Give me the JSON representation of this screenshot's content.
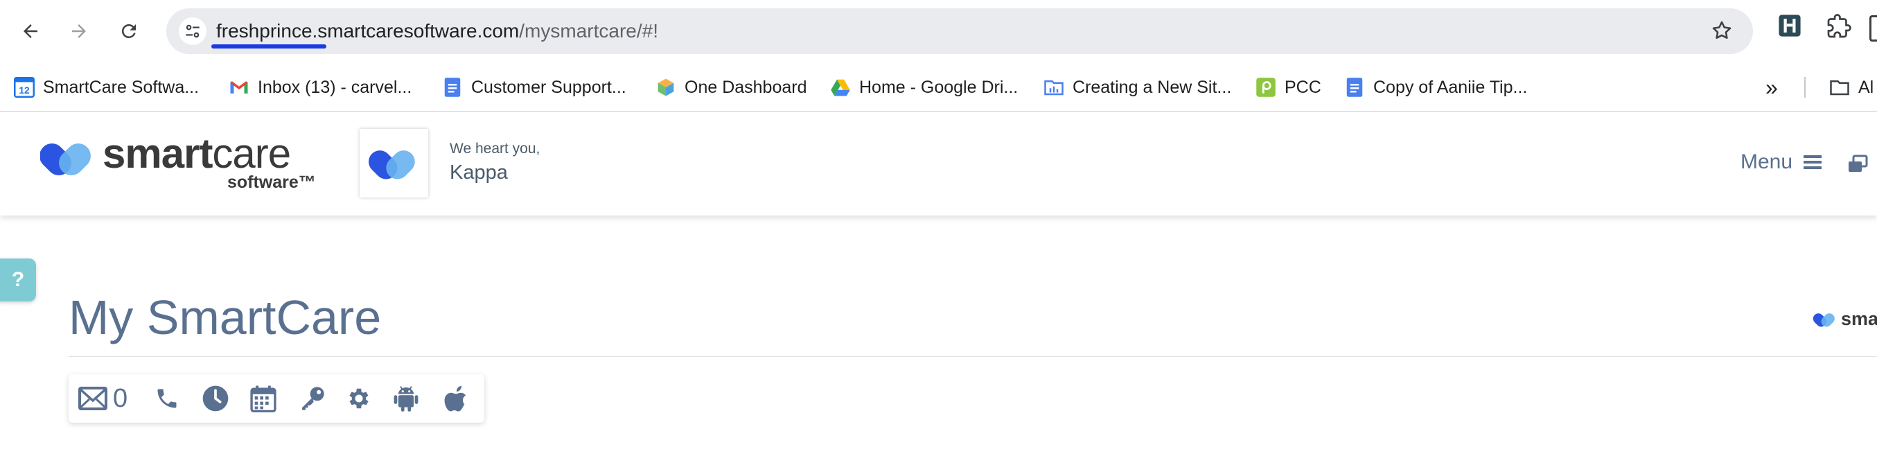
{
  "browser": {
    "url_host": "freshprince.smartcaresoftware.com",
    "url_path": "/mysmartcare/#!",
    "nav": {
      "back_icon": "arrow-left-icon",
      "forward_icon": "arrow-right-icon",
      "reload_icon": "reload-icon",
      "site_info_icon": "tune-icon",
      "bookmark_star_icon": "star-icon"
    },
    "extensions": [
      {
        "name": "extension-app-icon"
      },
      {
        "name": "puzzle-icon"
      }
    ]
  },
  "bookmarks": [
    {
      "label": "SmartCare Softwa...",
      "icon": "calendar-12-icon"
    },
    {
      "label": "Inbox (13) - carvel...",
      "icon": "gmail-icon"
    },
    {
      "label": "Customer Support...",
      "icon": "google-docs-icon"
    },
    {
      "label": "One Dashboard",
      "icon": "cube-icon"
    },
    {
      "label": "Home - Google Dri...",
      "icon": "google-drive-icon"
    },
    {
      "label": "Creating a New Sit...",
      "icon": "folder-chart-icon"
    },
    {
      "label": "PCC",
      "icon": "pcc-icon"
    },
    {
      "label": "Copy of Aaniie Tip...",
      "icon": "google-docs-icon"
    }
  ],
  "bookmarks_overflow": "»",
  "bookmarks_all_partial": "Al",
  "site": {
    "logo_word_smart": "smart",
    "logo_word_care": "care",
    "logo_sub": "software™",
    "greeting": "We heart you,",
    "user_name": "Kappa",
    "menu_label": "Menu",
    "help_label": "?",
    "page_title": "My SmartCare",
    "brand_mini": "smar"
  },
  "icon_toolbar": {
    "mail_count": "0",
    "icons": [
      "envelope-icon",
      "phone-icon",
      "clock-icon",
      "calendar-icon",
      "key-icon",
      "gear-icon",
      "android-icon",
      "apple-icon"
    ]
  },
  "colors": {
    "accent_blue": "#1a3be0",
    "slate_text": "#5a7090",
    "logo_blue": "#2b55e0",
    "logo_light_blue": "#67b3ef",
    "help_tab": "#7ecbd4"
  }
}
